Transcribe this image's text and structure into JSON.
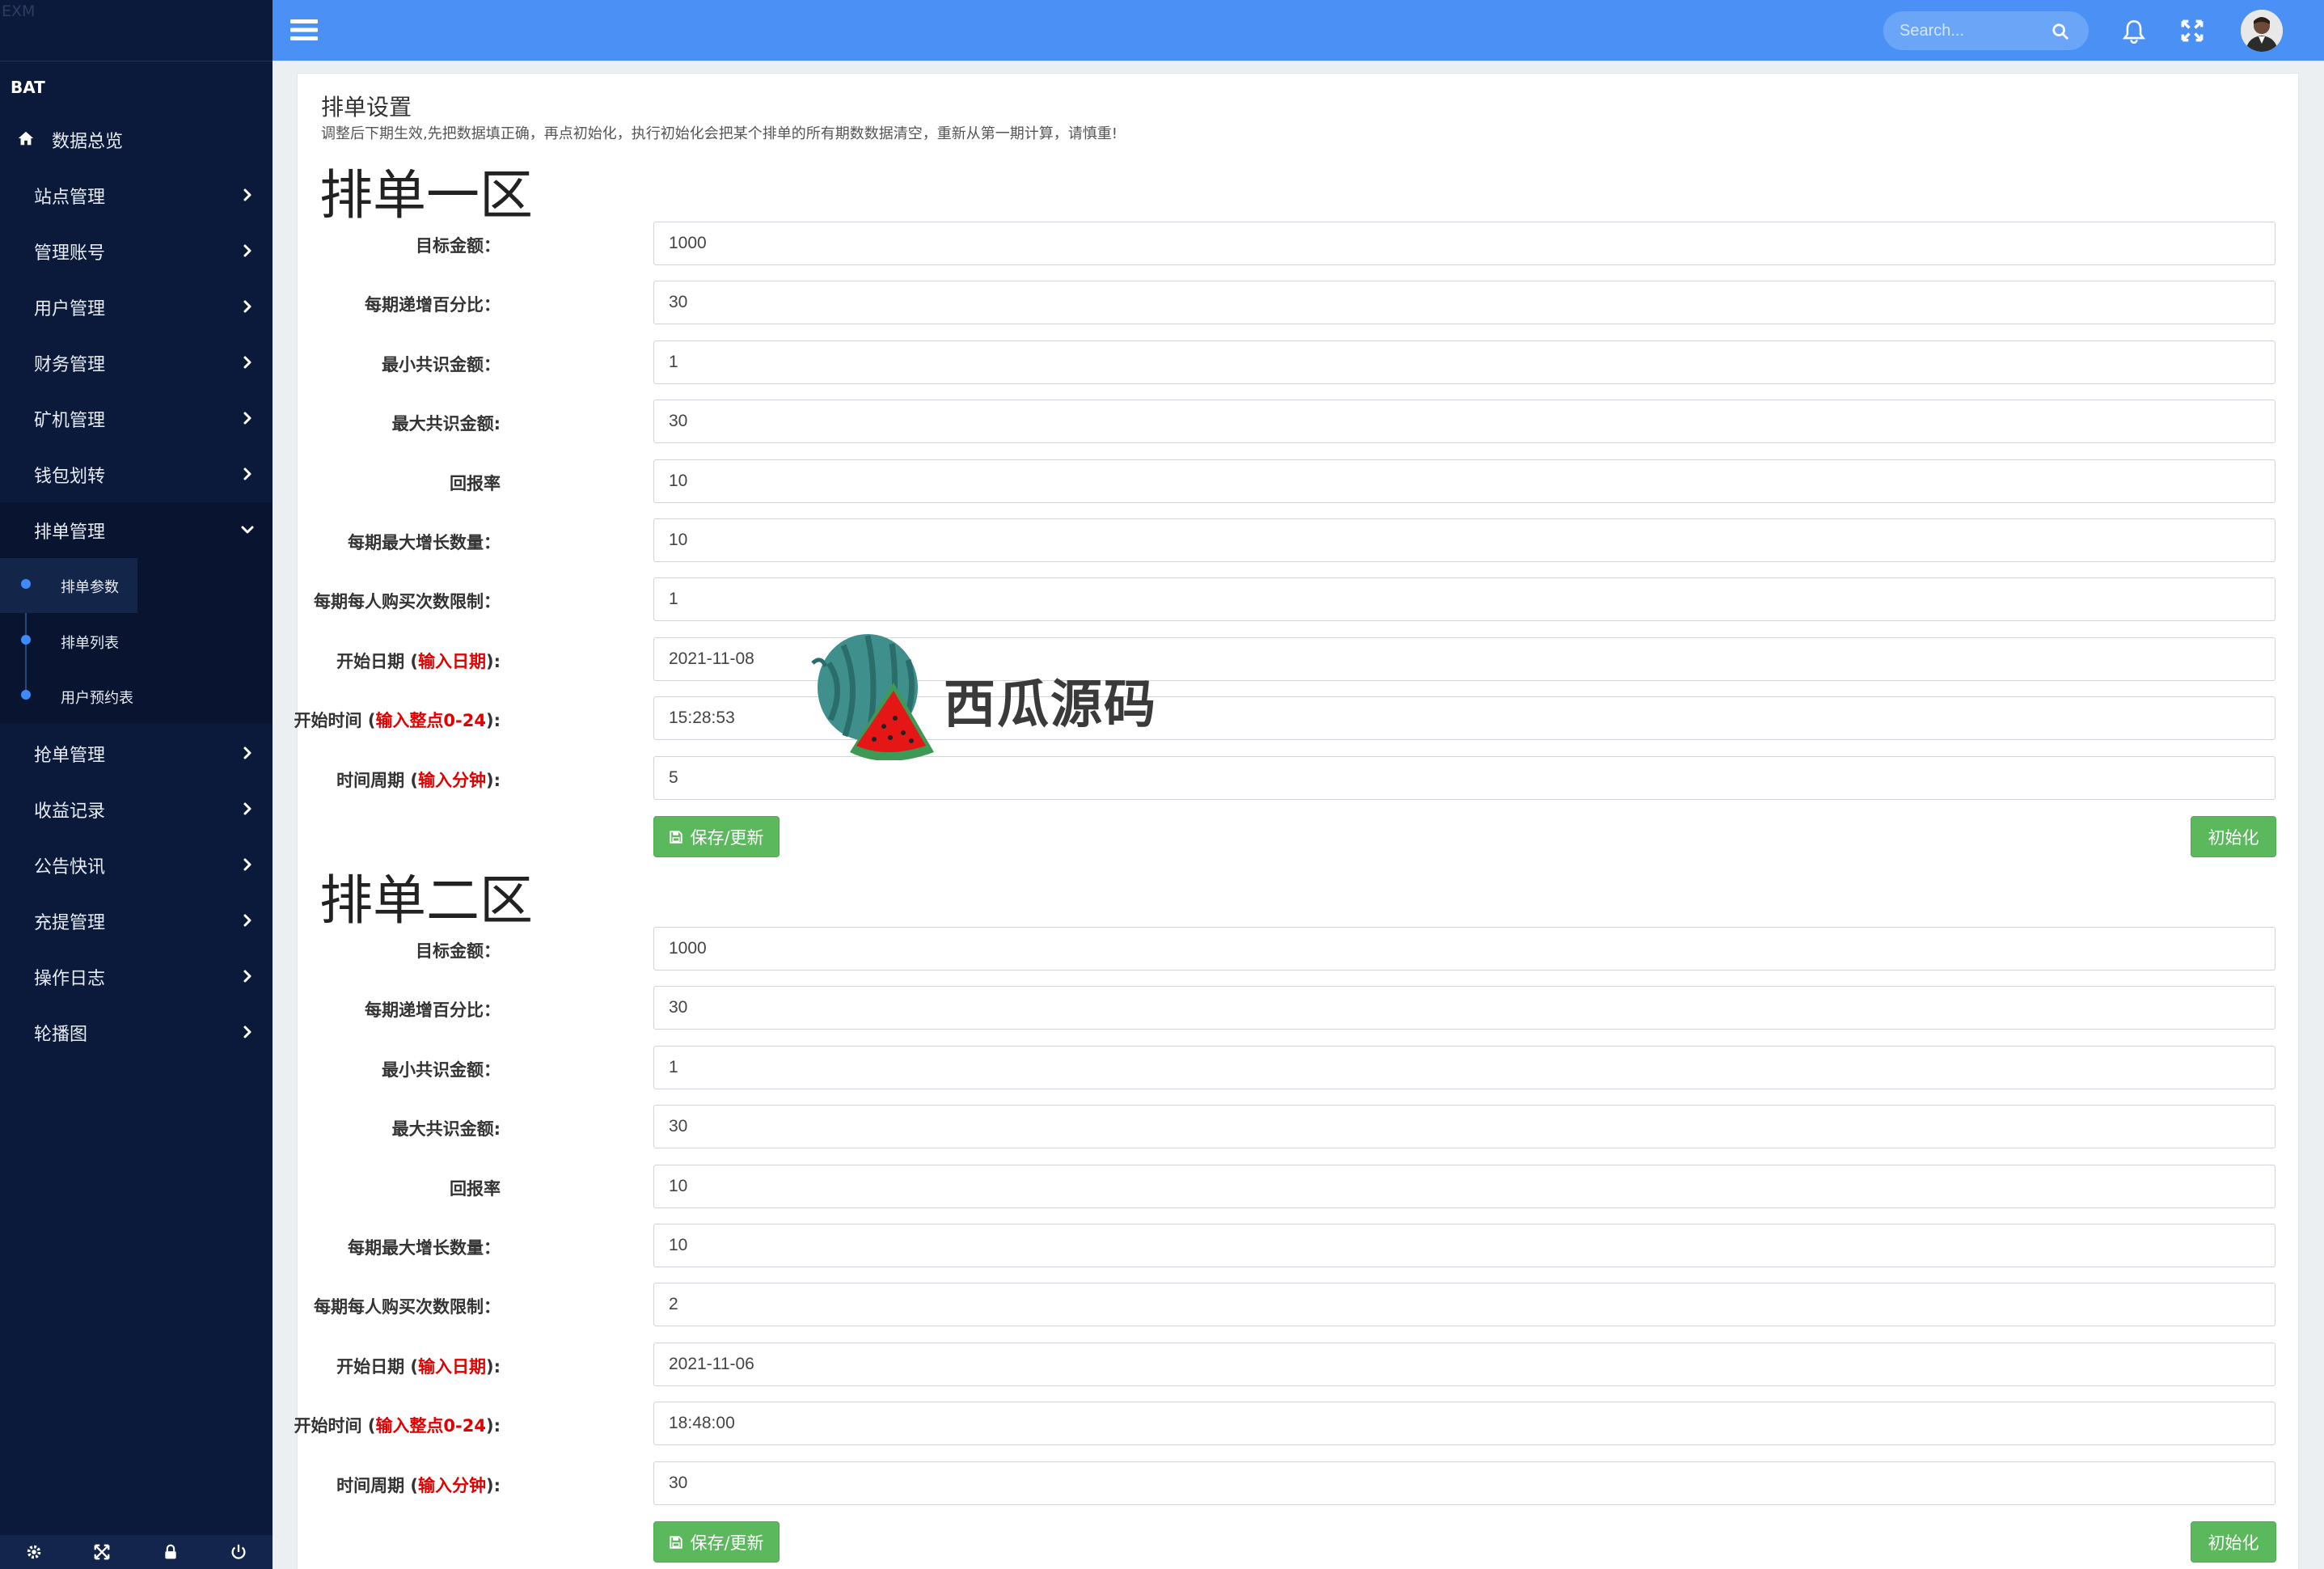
{
  "sidebar": {
    "top_label": "EXM",
    "brand": "BAT",
    "home": "数据总览",
    "items": [
      {
        "label": "站点管理"
      },
      {
        "label": "管理账号"
      },
      {
        "label": "用户管理"
      },
      {
        "label": "财务管理"
      },
      {
        "label": "矿机管理"
      },
      {
        "label": "钱包划转"
      },
      {
        "label": "排单管理"
      }
    ],
    "sub_items": [
      {
        "label": "排单参数"
      },
      {
        "label": "排单列表"
      },
      {
        "label": "用户预约表"
      }
    ],
    "items_after": [
      {
        "label": "抢单管理"
      },
      {
        "label": "收益记录"
      },
      {
        "label": "公告快讯"
      },
      {
        "label": "充提管理"
      },
      {
        "label": "操作日志"
      },
      {
        "label": "轮播图"
      }
    ],
    "accent_color": "#3d8bfd",
    "background_color": "#0b1a3b"
  },
  "topbar": {
    "search_placeholder": "Search...",
    "background_color": "#4a90f5"
  },
  "panel": {
    "title": "排单设置",
    "description": "调整后下期生效,先把数据填正确，再点初始化，执行初始化会把某个排单的所有期数数据清空，重新从第一期计算，请慎重!"
  },
  "sections": [
    {
      "title": "排单一区",
      "fields": [
        {
          "label": "目标金额：",
          "value": "1000"
        },
        {
          "label": "每期递增百分比：",
          "value": "30"
        },
        {
          "label": "最小共识金额：",
          "value": "1"
        },
        {
          "label": "最大共识金额:",
          "value": "30"
        },
        {
          "label": "回报率",
          "value": "10"
        },
        {
          "label": "每期最大增长数量：",
          "value": "10"
        },
        {
          "label": "每期每人购买次数限制：",
          "value": "1"
        },
        {
          "label": "开始日期 (",
          "hint": "输入日期",
          "suffix": "):",
          "value": "2021-11-08"
        },
        {
          "label": "开始时间 (",
          "hint": "输入整点0-24",
          "suffix": "):",
          "value": "15:28:53"
        },
        {
          "label": "时间周期 (",
          "hint": "输入分钟",
          "suffix": "):",
          "value": "5"
        }
      ],
      "save_label": "保存/更新",
      "init_label": "初始化"
    },
    {
      "title": "排单二区",
      "fields": [
        {
          "label": "目标金额：",
          "value": "1000"
        },
        {
          "label": "每期递增百分比：",
          "value": "30"
        },
        {
          "label": "最小共识金额：",
          "value": "1"
        },
        {
          "label": "最大共识金额:",
          "value": "30"
        },
        {
          "label": "回报率",
          "value": "10"
        },
        {
          "label": "每期最大增长数量：",
          "value": "10"
        },
        {
          "label": "每期每人购买次数限制：",
          "value": "2"
        },
        {
          "label": "开始日期 (",
          "hint": "输入日期",
          "suffix": "):",
          "value": "2021-11-06"
        },
        {
          "label": "开始时间 (",
          "hint": "输入整点0-24",
          "suffix": "):",
          "value": "18:48:00"
        },
        {
          "label": "时间周期 (",
          "hint": "输入分钟",
          "suffix": "):",
          "value": "30"
        }
      ],
      "save_label": "保存/更新",
      "init_label": "初始化"
    }
  ],
  "watermark": {
    "text": "西瓜源码"
  },
  "colors": {
    "save_button": "#5cb85c",
    "hint_red": "#e10000"
  }
}
